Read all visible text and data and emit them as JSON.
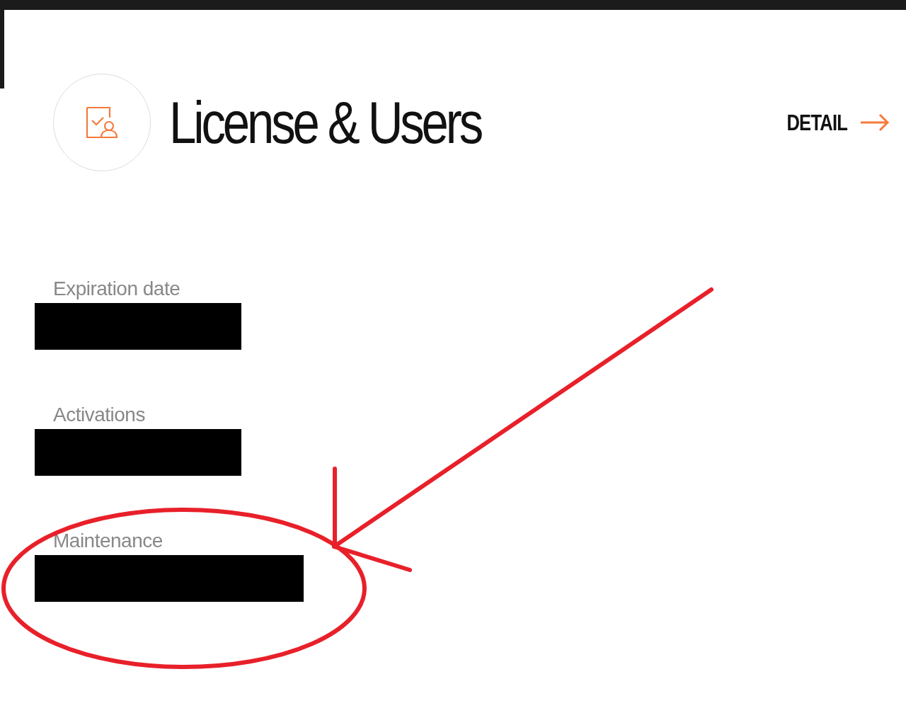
{
  "header": {
    "title": "License & Users",
    "link": {
      "label": "DETAIL"
    }
  },
  "fields": [
    {
      "label": "Expiration date",
      "kind": "redacted"
    },
    {
      "label": "Activations",
      "kind": "redacted"
    },
    {
      "label": "Maintenance",
      "kind": "redacted"
    }
  ]
}
